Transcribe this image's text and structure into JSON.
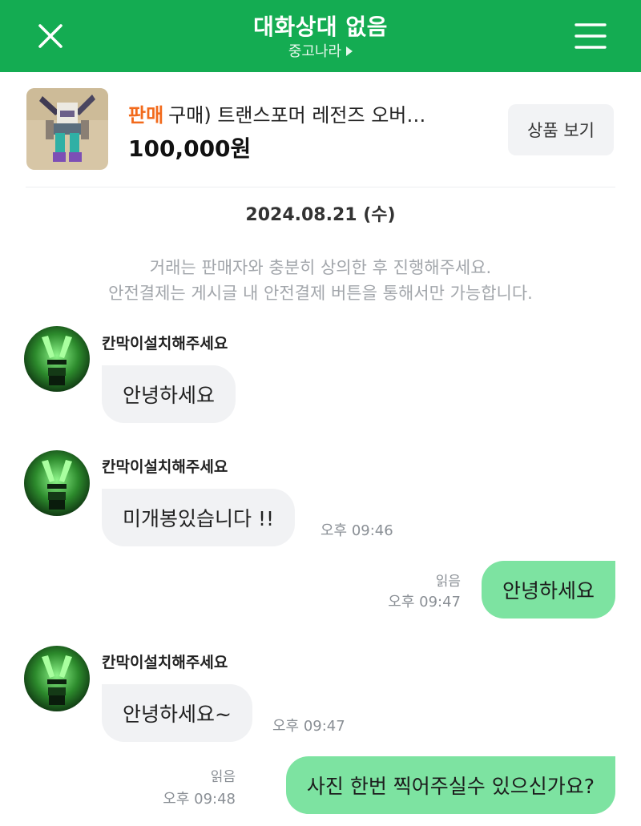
{
  "header": {
    "title": "대화상대 없음",
    "subtitle": "중고나라",
    "bg_color": "#14ac52"
  },
  "product": {
    "tag": "판매",
    "title": "구매) 트랜스포머 레전즈 오버…",
    "price": "100,000원",
    "view_button": "상품 보기",
    "tag_color": "#f26a1b"
  },
  "chat": {
    "date": "2024.08.21 (수)",
    "notice_line1": "거래는 판매자와 충분히 상의한 후 진행해주세요.",
    "notice_line2": "안전결제는 게시글 내 안전결제 버튼을 통해서만 가능합니다.",
    "messages": [
      {
        "sender": "칸막이설치해주세요",
        "text": "안녕하세요"
      },
      {
        "sender": "칸막이설치해주세요",
        "text": "미개봉있습니다 !!",
        "time": "오후 09:46"
      },
      {
        "text": "안녕하세요",
        "read": "읽음",
        "time": "오후 09:47"
      },
      {
        "sender": "칸막이설치해주세요",
        "text": "안녕하세요~",
        "time": "오후 09:47"
      },
      {
        "text": "사진 한번 찍어주실수 있으신가요?",
        "read": "읽음",
        "time": "오후 09:48"
      }
    ]
  },
  "colors": {
    "outgoing_bubble": "#7de3a1",
    "incoming_bubble": "#f1f2f4"
  },
  "icons": [
    "close-icon",
    "menu-icon",
    "chevron-right-icon"
  ]
}
